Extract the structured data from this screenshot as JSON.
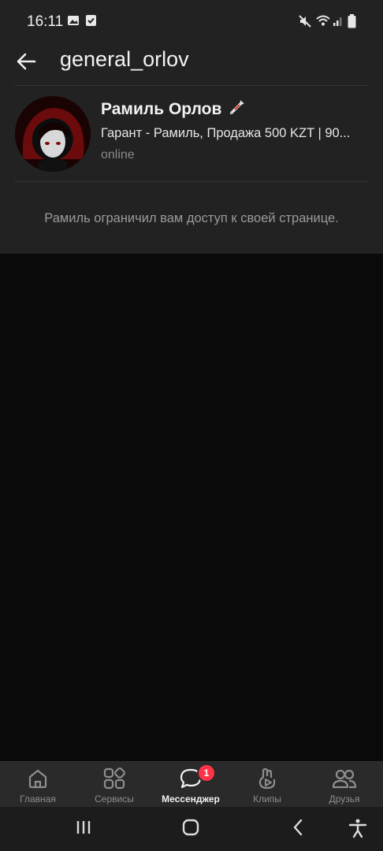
{
  "status_bar": {
    "time": "16:11"
  },
  "header": {
    "title": "general_orlov"
  },
  "profile": {
    "name": "Рамиль Орлов",
    "status_text": "Гарант - Рамиль, Продажа 500 KZT | 90...",
    "online": "online",
    "restricted_message": "Рамиль ограничил вам доступ к своей странице."
  },
  "bottom_nav": {
    "items": [
      {
        "label": "Главная",
        "icon": "home-icon"
      },
      {
        "label": "Сервисы",
        "icon": "services-icon"
      },
      {
        "label": "Мессенджер",
        "icon": "messenger-icon",
        "badge": "1"
      },
      {
        "label": "Клипы",
        "icon": "clips-icon"
      },
      {
        "label": "Друзья",
        "icon": "friends-icon"
      }
    ]
  },
  "colors": {
    "background": "#0a0a0a",
    "surface": "#222222",
    "badge": "#ff3347",
    "muted_text": "#8a8a8a"
  }
}
